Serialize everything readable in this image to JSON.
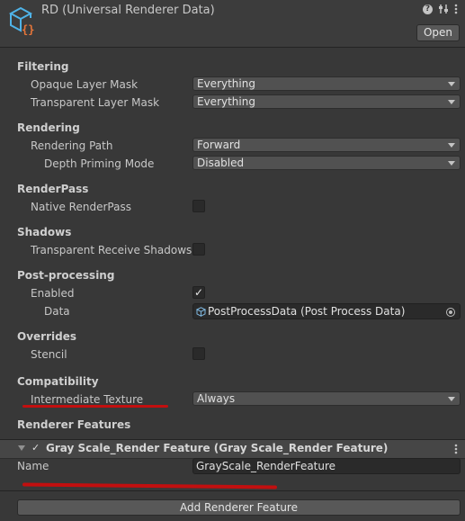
{
  "header": {
    "title": "RD (Universal Renderer Data)",
    "open_label": "Open",
    "icons": [
      "asset-icon",
      "help-icon",
      "preset-sliders-icon",
      "kebab-menu-icon"
    ]
  },
  "filtering": {
    "heading": "Filtering",
    "opaque_label": "Opaque Layer Mask",
    "opaque_value": "Everything",
    "transparent_label": "Transparent Layer Mask",
    "transparent_value": "Everything"
  },
  "rendering": {
    "heading": "Rendering",
    "path_label": "Rendering Path",
    "path_value": "Forward",
    "depth_label": "Depth Priming Mode",
    "depth_value": "Disabled"
  },
  "renderpass": {
    "heading": "RenderPass",
    "native_label": "Native RenderPass",
    "native_checked": false
  },
  "shadows": {
    "heading": "Shadows",
    "receive_label": "Transparent Receive Shadows",
    "receive_checked": false
  },
  "postprocessing": {
    "heading": "Post-processing",
    "enabled_label": "Enabled",
    "enabled_checked": true,
    "data_label": "Data",
    "data_value": "PostProcessData (Post Process Data)"
  },
  "overrides": {
    "heading": "Overrides",
    "stencil_label": "Stencil",
    "stencil_checked": false
  },
  "compatibility": {
    "heading": "Compatibility",
    "intermediate_label": "Intermediate Texture",
    "intermediate_value": "Always"
  },
  "renderer_features": {
    "heading": "Renderer Features",
    "feature_title": "Gray Scale_Render Feature (Gray Scale_Render Feature)",
    "feature_enabled": true,
    "name_label": "Name",
    "name_value": "GrayScale_RenderFeature",
    "add_label": "Add Renderer Feature"
  },
  "colors": {
    "background": "#383838",
    "annotation_red": "#c20f0f",
    "asset_icon_blue": "#4fb3e8",
    "asset_icon_orange": "#e8763a"
  }
}
